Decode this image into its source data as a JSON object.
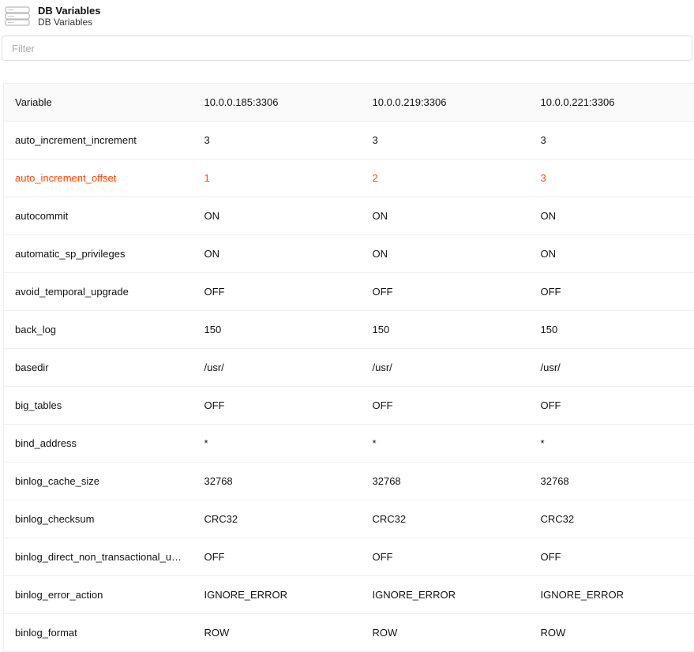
{
  "header": {
    "title": "DB Variables",
    "subtitle": "DB Variables"
  },
  "filter": {
    "placeholder": "Filter"
  },
  "table": {
    "columns": [
      "Variable",
      "10.0.0.185:3306",
      "10.0.0.219:3306",
      "10.0.0.221:3306"
    ],
    "rows": [
      {
        "variable": "auto_increment_increment",
        "values": [
          "3",
          "3",
          "3"
        ],
        "diff": false
      },
      {
        "variable": "auto_increment_offset",
        "values": [
          "1",
          "2",
          "3"
        ],
        "diff": true
      },
      {
        "variable": "autocommit",
        "values": [
          "ON",
          "ON",
          "ON"
        ],
        "diff": false
      },
      {
        "variable": "automatic_sp_privileges",
        "values": [
          "ON",
          "ON",
          "ON"
        ],
        "diff": false
      },
      {
        "variable": "avoid_temporal_upgrade",
        "values": [
          "OFF",
          "OFF",
          "OFF"
        ],
        "diff": false
      },
      {
        "variable": "back_log",
        "values": [
          "150",
          "150",
          "150"
        ],
        "diff": false
      },
      {
        "variable": "basedir",
        "values": [
          "/usr/",
          "/usr/",
          "/usr/"
        ],
        "diff": false
      },
      {
        "variable": "big_tables",
        "values": [
          "OFF",
          "OFF",
          "OFF"
        ],
        "diff": false
      },
      {
        "variable": "bind_address",
        "values": [
          "*",
          "*",
          "*"
        ],
        "diff": false
      },
      {
        "variable": "binlog_cache_size",
        "values": [
          "32768",
          "32768",
          "32768"
        ],
        "diff": false
      },
      {
        "variable": "binlog_checksum",
        "values": [
          "CRC32",
          "CRC32",
          "CRC32"
        ],
        "diff": false
      },
      {
        "variable": "binlog_direct_non_transactional_updates",
        "values": [
          "OFF",
          "OFF",
          "OFF"
        ],
        "diff": false
      },
      {
        "variable": "binlog_error_action",
        "values": [
          "IGNORE_ERROR",
          "IGNORE_ERROR",
          "IGNORE_ERROR"
        ],
        "diff": false
      },
      {
        "variable": "binlog_format",
        "values": [
          "ROW",
          "ROW",
          "ROW"
        ],
        "diff": false
      }
    ]
  }
}
